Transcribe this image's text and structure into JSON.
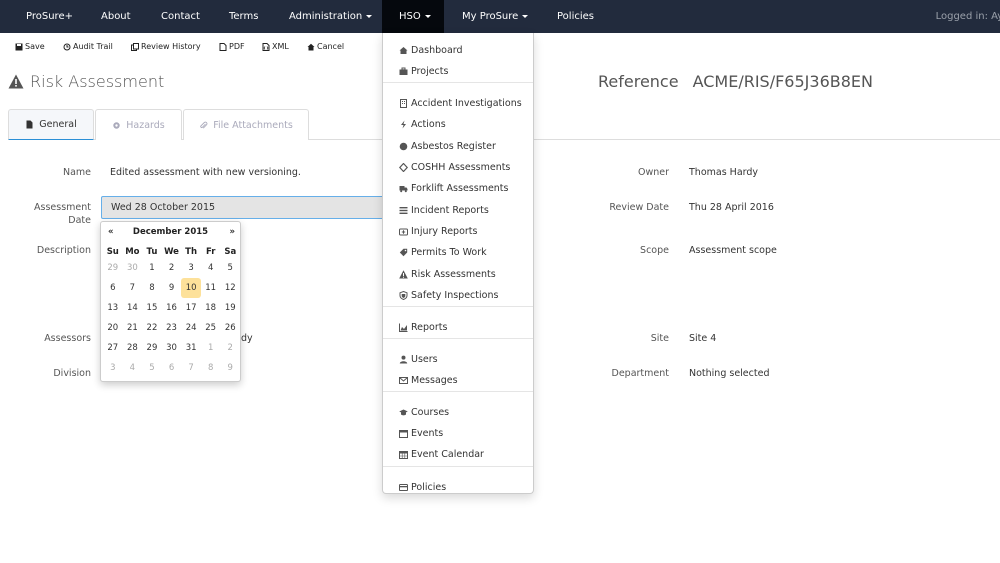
{
  "nav": {
    "brand": "ProSure+",
    "items": [
      "About",
      "Contact",
      "Terms",
      "Administration",
      "HSO",
      "My ProSure",
      "Policies"
    ],
    "logged_in": "Logged in: Ayl"
  },
  "toolbar": {
    "save": "Save",
    "audit_trail": "Audit Trail",
    "review_history": "Review History",
    "pdf": "PDF",
    "xml": "XML",
    "cancel": "Cancel"
  },
  "page": {
    "title": "Risk Assessment",
    "reference_label": "Reference",
    "reference_value": "ACME/RIS/F65J36B8EN"
  },
  "tabs": [
    "General",
    "Hazards",
    "File Attachments"
  ],
  "form": {
    "name_label": "Name",
    "name_value": "Edited assessment with new versioning.",
    "assessment_date_label_1": "Assessment",
    "assessment_date_label_2": "Date",
    "assessment_date_value": "Wed 28 October 2015",
    "description_label": "Description",
    "assessors_label": "Assessors",
    "assessors_value_tail": "dy",
    "division_label": "Division",
    "owner_label": "Owner",
    "owner_value": "Thomas Hardy",
    "review_date_label": "Review Date",
    "review_date_value": "Thu 28 April 2016",
    "scope_label": "Scope",
    "scope_value": "Assessment scope",
    "site_label": "Site",
    "site_value": "Site 4",
    "department_label": "Department",
    "department_value": "Nothing selected"
  },
  "datepicker": {
    "prev": "«",
    "next": "»",
    "title": "December 2015",
    "dow": [
      "Su",
      "Mo",
      "Tu",
      "We",
      "Th",
      "Fr",
      "Sa"
    ],
    "weeks": [
      [
        "29",
        "30",
        "1",
        "2",
        "3",
        "4",
        "5"
      ],
      [
        "6",
        "7",
        "8",
        "9",
        "10",
        "11",
        "12"
      ],
      [
        "13",
        "14",
        "15",
        "16",
        "17",
        "18",
        "19"
      ],
      [
        "20",
        "21",
        "22",
        "23",
        "24",
        "25",
        "26"
      ],
      [
        "27",
        "28",
        "29",
        "30",
        "31",
        "1",
        "2"
      ],
      [
        "3",
        "4",
        "5",
        "6",
        "7",
        "8",
        "9"
      ]
    ],
    "today": "10"
  },
  "hso_menu": {
    "groups": [
      [
        {
          "label": "Dashboard",
          "icon": "home-icon"
        },
        {
          "label": "Projects",
          "icon": "briefcase-icon"
        }
      ],
      [
        {
          "label": "Accident Investigations",
          "icon": "building-icon"
        },
        {
          "label": "Actions",
          "icon": "bolt-icon"
        },
        {
          "label": "Asbestos Register",
          "icon": "circle-icon"
        },
        {
          "label": "COSHH Assessments",
          "icon": "flask-icon"
        },
        {
          "label": "Forklift Assessments",
          "icon": "truck-icon"
        },
        {
          "label": "Incident Reports",
          "icon": "list-icon"
        },
        {
          "label": "Injury Reports",
          "icon": "medkit-icon"
        },
        {
          "label": "Permits To Work",
          "icon": "tag-icon"
        },
        {
          "label": "Risk Assessments",
          "icon": "warning-icon"
        },
        {
          "label": "Safety Inspections",
          "icon": "shield-icon"
        }
      ],
      [
        {
          "label": "Reports",
          "icon": "chart-icon"
        }
      ],
      [
        {
          "label": "Users",
          "icon": "user-icon"
        },
        {
          "label": "Messages",
          "icon": "envelope-icon"
        }
      ],
      [
        {
          "label": "Courses",
          "icon": "graduation-cap-icon"
        },
        {
          "label": "Events",
          "icon": "calendar-icon"
        },
        {
          "label": "Event Calendar",
          "icon": "calendar-grid-icon"
        }
      ],
      [
        {
          "label": "Policies",
          "icon": "credit-card-icon"
        }
      ]
    ]
  }
}
